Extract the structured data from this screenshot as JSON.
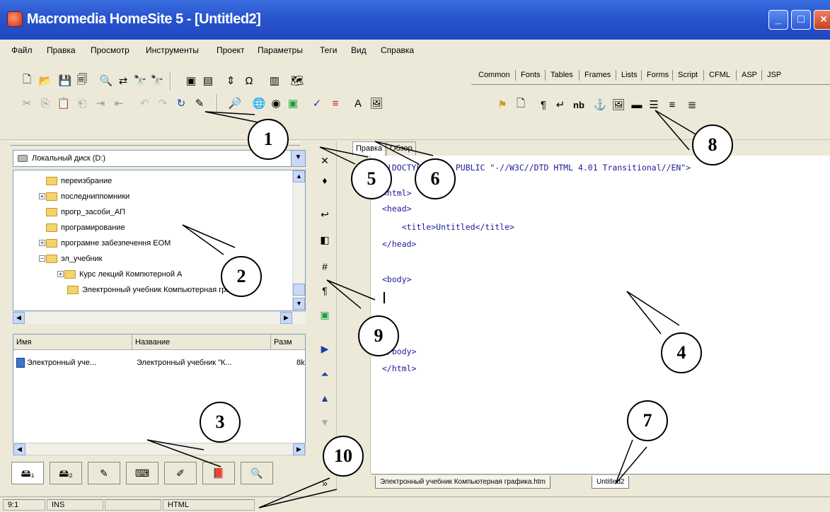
{
  "window": {
    "title": "Macromedia HomeSite 5 - [Untitled2]",
    "controls": [
      "minimize-icon",
      "maximize-icon",
      "close-icon"
    ]
  },
  "menu": [
    "Файл",
    "Правка",
    "Просмотр",
    "Инструменты",
    "Проект",
    "Параметры",
    "Теги",
    "Вид",
    "Справка"
  ],
  "tag_toolbar": {
    "tabs": [
      "Common",
      "Fonts",
      "Tables",
      "Frames",
      "Lists",
      "Forms",
      "Script",
      "CFML",
      "ASP",
      "JSP"
    ],
    "nb_label": "nb"
  },
  "resource_pane": {
    "drive": "Локальный диск (D:)",
    "tree": [
      "переизбрание",
      "последниппомники",
      "прогр_засоби_АП",
      "програмирование",
      "програмне забезпечення ЕОМ",
      "эл_учебник",
      "Курс лекций Компютерной А",
      "Электронный учебник Компьютерная графика"
    ],
    "columns": [
      "Имя",
      "Название",
      "Разм"
    ],
    "files": [
      {
        "name": "Электронный уче...",
        "title": "Электронный учебник \"К...",
        "size": "8k"
      }
    ]
  },
  "editor": {
    "tabs": [
      "Правка",
      "Обзор"
    ],
    "code": [
      "<!DOCTYPE HTML PUBLIC \"-//W3C//DTD HTML 4.01 Transitional//EN\">",
      "",
      "<html>",
      "<head>",
      "    <title>Untitled</title>",
      "</head>",
      "",
      "<body>",
      "",
      "",
      "",
      "",
      "</body>",
      "</html>"
    ],
    "documents": [
      "Электронный учебник Компьютерная графика.htm",
      "Untitled2"
    ]
  },
  "status": {
    "position": "9:1",
    "mode": "INS",
    "doc_type": "HTML"
  },
  "callouts": [
    "1",
    "2",
    "3",
    "4",
    "5",
    "6",
    "7",
    "8",
    "9",
    "10"
  ]
}
